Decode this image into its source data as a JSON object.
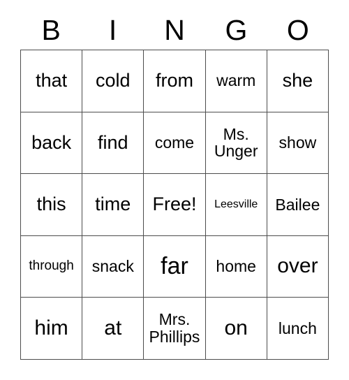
{
  "card": {
    "header": {
      "letters": [
        "B",
        "I",
        "N",
        "G",
        "O"
      ]
    },
    "rows": [
      [
        {
          "text": "that",
          "size": "md"
        },
        {
          "text": "cold",
          "size": "md"
        },
        {
          "text": "from",
          "size": "md"
        },
        {
          "text": "warm",
          "size": "sm"
        },
        {
          "text": "she",
          "size": "md"
        }
      ],
      [
        {
          "text": "back",
          "size": "md"
        },
        {
          "text": "find",
          "size": "md"
        },
        {
          "text": "come",
          "size": "sm"
        },
        {
          "text": "Ms.\nUnger",
          "size": "sm"
        },
        {
          "text": "show",
          "size": "sm"
        }
      ],
      [
        {
          "text": "this",
          "size": "md"
        },
        {
          "text": "time",
          "size": "md"
        },
        {
          "text": "Free!",
          "size": "md"
        },
        {
          "text": "Leesville",
          "size": "xxs"
        },
        {
          "text": "Bailee",
          "size": "sm"
        }
      ],
      [
        {
          "text": "through",
          "size": "xs"
        },
        {
          "text": "snack",
          "size": "sm"
        },
        {
          "text": "far",
          "size": "xl"
        },
        {
          "text": "home",
          "size": "sm"
        },
        {
          "text": "over",
          "size": "lg"
        }
      ],
      [
        {
          "text": "him",
          "size": "lg"
        },
        {
          "text": "at",
          "size": "lg"
        },
        {
          "text": "Mrs.\nPhillips",
          "size": "sm"
        },
        {
          "text": "on",
          "size": "lg"
        },
        {
          "text": "lunch",
          "size": "sm"
        }
      ]
    ]
  },
  "colors": {
    "border": "#4d4d4d",
    "text": "#000000",
    "background": "#ffffff"
  }
}
